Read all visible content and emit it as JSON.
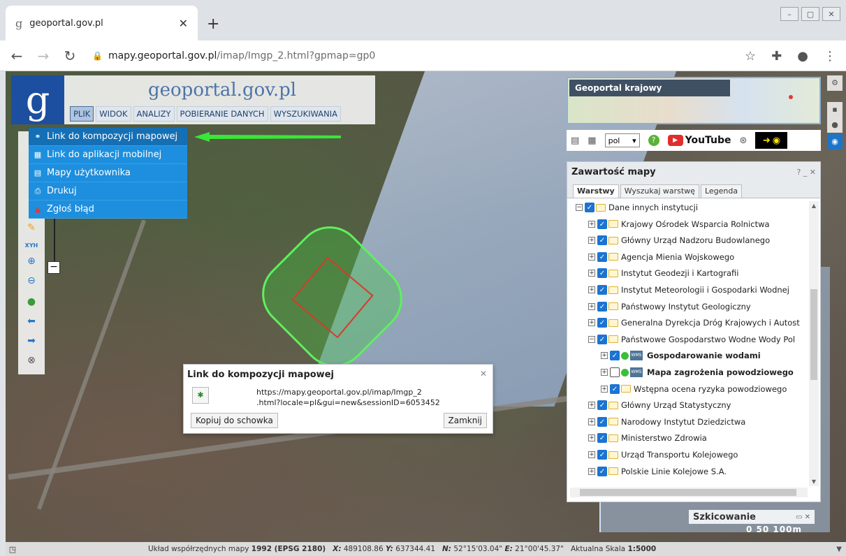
{
  "browser": {
    "tab_title": "geoportal.gov.pl",
    "tab_favicon": "g",
    "url_host": "mapy.geoportal.gov.pl",
    "url_path": "/imap/Imgp_2.html?gpmap=gp0"
  },
  "header": {
    "logo_letter": "g",
    "logo_text": "geoportal.gov.pl",
    "menu": [
      "PLIK",
      "WIDOK",
      "ANALIZY",
      "POBIERANIE DANYCH",
      "WYSZUKIWANIA"
    ]
  },
  "file_menu": {
    "items": [
      {
        "label": "Link do kompozycji mapowej",
        "icon": "link-icon"
      },
      {
        "label": "Link do aplikacji mobilnej",
        "icon": "qr-icon"
      },
      {
        "label": "Mapy użytkownika",
        "icon": "user-maps-icon"
      },
      {
        "label": "Drukuj",
        "icon": "print-icon"
      },
      {
        "label": "Zgłoś błąd",
        "icon": "warning-icon"
      }
    ]
  },
  "tools": {
    "xyh": "XYH"
  },
  "overview": {
    "label": "Geoportal krajowy"
  },
  "iconbar": {
    "lang": "pol",
    "help": "?",
    "youtube": "YouTube"
  },
  "layers": {
    "title": "Zawartość mapy",
    "controls": "? _ ✕",
    "tabs": [
      "Warstwy",
      "Wyszukaj warstwę",
      "Legenda"
    ],
    "items": [
      {
        "label": "Dane innych instytucji",
        "level": 0,
        "exp": "−",
        "checked": true,
        "type": "folder"
      },
      {
        "label": "Krajowy Ośrodek Wsparcia Rolnictwa",
        "level": 1,
        "exp": "+",
        "checked": true,
        "type": "folder"
      },
      {
        "label": "Główny Urząd Nadzoru Budowlanego",
        "level": 1,
        "exp": "+",
        "checked": true,
        "type": "folder"
      },
      {
        "label": "Agencja Mienia Wojskowego",
        "level": 1,
        "exp": "+",
        "checked": true,
        "type": "folder"
      },
      {
        "label": "Instytut Geodezji i Kartografii",
        "level": 1,
        "exp": "+",
        "checked": true,
        "type": "folder"
      },
      {
        "label": "Instytut Meteorologii i Gospodarki Wodnej",
        "level": 1,
        "exp": "+",
        "checked": true,
        "type": "folder"
      },
      {
        "label": "Państwowy Instytut Geologiczny",
        "level": 1,
        "exp": "+",
        "checked": true,
        "type": "folder"
      },
      {
        "label": "Generalna Dyrekcja Dróg Krajowych i Autost",
        "level": 1,
        "exp": "+",
        "checked": true,
        "type": "folder"
      },
      {
        "label": "Państwowe Gospodarstwo Wodne Wody Pol",
        "level": 1,
        "exp": "−",
        "checked": true,
        "type": "folder"
      },
      {
        "label": "Gospodarowanie wodami",
        "level": 2,
        "exp": "+",
        "checked": true,
        "type": "wms"
      },
      {
        "label": "Mapa zagrożenia powodziowego",
        "level": 2,
        "exp": "+",
        "checked": false,
        "type": "wms"
      },
      {
        "label": "Wstępna ocena ryzyka powodziowego",
        "level": 2,
        "exp": "+",
        "checked": true,
        "type": "folder"
      },
      {
        "label": "Główny Urząd Statystyczny",
        "level": 1,
        "exp": "+",
        "checked": true,
        "type": "folder"
      },
      {
        "label": "Narodowy Instytut Dziedzictwa",
        "level": 1,
        "exp": "+",
        "checked": true,
        "type": "folder"
      },
      {
        "label": "Ministerstwo Zdrowia",
        "level": 1,
        "exp": "+",
        "checked": true,
        "type": "folder"
      },
      {
        "label": "Urząd Transportu Kolejowego",
        "level": 1,
        "exp": "+",
        "checked": true,
        "type": "folder"
      },
      {
        "label": "Polskie Linie Kolejowe S.A.",
        "level": 1,
        "exp": "+",
        "checked": true,
        "type": "folder"
      }
    ]
  },
  "dialog": {
    "title": "Link do kompozycji mapowej",
    "url_line1": "https://mapy.geoportal.gov.pl/imap/Imgp_2",
    "url_line2": ".html?locale=pl&gui=new&sessionID=6053452",
    "copy_label": "Kopiuj do schowka",
    "close_label": "Zamknij"
  },
  "sketch": {
    "title": "Szkicowanie",
    "scale": "0   50  100m"
  },
  "status": {
    "crs_label": "Układ współrzędnych mapy",
    "crs_value": "1992 (EPSG 2180)",
    "x_label": "X:",
    "x_value": "489108.86",
    "y_label": "Y:",
    "y_value": "637344.41",
    "n_label": "N:",
    "n_value": "52°15'03.04\"",
    "e_label": "E:",
    "e_value": "21°00'45.37\"",
    "scale_label": "Aktualna Skala",
    "scale_value": "1:5000"
  },
  "colors": {
    "accent": "#1d8fde",
    "aoi_outline": "#5ef05e",
    "aoi_inner": "#d9392b"
  }
}
